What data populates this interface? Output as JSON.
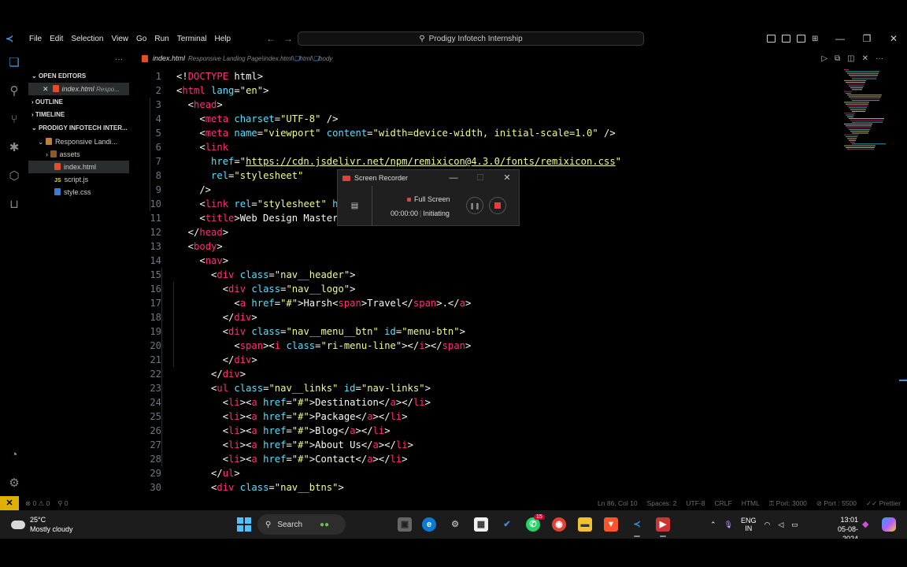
{
  "menu": [
    "File",
    "Edit",
    "Selection",
    "View",
    "Go",
    "Run",
    "Terminal",
    "Help"
  ],
  "command_center": "Prodigy Infotech Internship",
  "sidebar": {
    "open_editors": "OPEN EDITORS",
    "open_file": "index.html",
    "open_file_hint": "Respo...",
    "outline": "OUTLINE",
    "timeline": "TIMELINE",
    "workspace": "PRODIGY INFOTECH INTER...",
    "folder": "Responsive Landi...",
    "items": [
      "assets",
      "index.html",
      "script.js",
      "style.css"
    ]
  },
  "tab": {
    "label": "index.html",
    "breadcrumb": "Responsive Landing Page\\index.html\\",
    "crumb_html": "html",
    "crumb_body": "body"
  },
  "code_lines": [
    [
      [
        "p",
        "<!"
      ],
      [
        "t",
        "DOCTYPE"
      ],
      [
        "p",
        " html>"
      ]
    ],
    [
      [
        "p",
        "<"
      ],
      [
        "t",
        "html"
      ],
      [
        "a",
        " lang"
      ],
      [
        "p",
        "="
      ],
      [
        "s",
        "\"en\""
      ],
      [
        "p",
        ">"
      ]
    ],
    [
      [
        "p",
        "  <"
      ],
      [
        "t",
        "head"
      ],
      [
        "p",
        ">"
      ]
    ],
    [
      [
        "p",
        "    <"
      ],
      [
        "t",
        "meta"
      ],
      [
        "a",
        " charset"
      ],
      [
        "p",
        "="
      ],
      [
        "s",
        "\"UTF-8\""
      ],
      [
        "p",
        " />"
      ]
    ],
    [
      [
        "p",
        "    <"
      ],
      [
        "t",
        "meta"
      ],
      [
        "a",
        " name"
      ],
      [
        "p",
        "="
      ],
      [
        "s",
        "\"viewport\""
      ],
      [
        "a",
        " content"
      ],
      [
        "p",
        "="
      ],
      [
        "s",
        "\"width=device-width, initial-scale=1.0\""
      ],
      [
        "p",
        " />"
      ]
    ],
    [
      [
        "p",
        "    <"
      ],
      [
        "t",
        "link"
      ]
    ],
    [
      [
        "a",
        "      href"
      ],
      [
        "p",
        "="
      ],
      [
        "s",
        "\""
      ],
      [
        "u",
        "https://cdn.jsdelivr.net/npm/remixicon@4.3.0/fonts/remixicon.css"
      ],
      [
        "s",
        "\""
      ]
    ],
    [
      [
        "a",
        "      rel"
      ],
      [
        "p",
        "="
      ],
      [
        "s",
        "\"stylesheet\""
      ]
    ],
    [
      [
        "p",
        "    />"
      ]
    ],
    [
      [
        "p",
        "    <"
      ],
      [
        "t",
        "link"
      ],
      [
        "a",
        " rel"
      ],
      [
        "p",
        "="
      ],
      [
        "s",
        "\"stylesheet\""
      ],
      [
        "a",
        " h"
      ]
    ],
    [
      [
        "p",
        "    <"
      ],
      [
        "t",
        "title"
      ],
      [
        "p",
        ">Web Design Master"
      ]
    ],
    [
      [
        "p",
        "  </"
      ],
      [
        "t",
        "head"
      ],
      [
        "p",
        ">"
      ]
    ],
    [
      [
        "p",
        "  <"
      ],
      [
        "t",
        "body"
      ],
      [
        "p",
        ">"
      ]
    ],
    [
      [
        "p",
        "    <"
      ],
      [
        "t",
        "nav"
      ],
      [
        "p",
        ">"
      ]
    ],
    [
      [
        "p",
        "      <"
      ],
      [
        "t",
        "div"
      ],
      [
        "a",
        " class"
      ],
      [
        "p",
        "="
      ],
      [
        "s",
        "\"nav__header\""
      ],
      [
        "p",
        ">"
      ]
    ],
    [
      [
        "p",
        "        <"
      ],
      [
        "t",
        "div"
      ],
      [
        "a",
        " class"
      ],
      [
        "p",
        "="
      ],
      [
        "s",
        "\"nav__logo\""
      ],
      [
        "p",
        ">"
      ]
    ],
    [
      [
        "p",
        "          <"
      ],
      [
        "t",
        "a"
      ],
      [
        "a",
        " href"
      ],
      [
        "p",
        "="
      ],
      [
        "s",
        "\"#\""
      ],
      [
        "p",
        ">Harsh<"
      ],
      [
        "t",
        "span"
      ],
      [
        "p",
        ">Travel</"
      ],
      [
        "t",
        "span"
      ],
      [
        "p",
        ">.</"
      ],
      [
        "t",
        "a"
      ],
      [
        "p",
        ">"
      ]
    ],
    [
      [
        "p",
        "        </"
      ],
      [
        "t",
        "div"
      ],
      [
        "p",
        ">"
      ]
    ],
    [
      [
        "p",
        "        <"
      ],
      [
        "t",
        "div"
      ],
      [
        "a",
        " class"
      ],
      [
        "p",
        "="
      ],
      [
        "s",
        "\"nav__menu__btn\""
      ],
      [
        "a",
        " id"
      ],
      [
        "p",
        "="
      ],
      [
        "s",
        "\"menu-btn\""
      ],
      [
        "p",
        ">"
      ]
    ],
    [
      [
        "p",
        "          <"
      ],
      [
        "t",
        "span"
      ],
      [
        "p",
        "><"
      ],
      [
        "t",
        "i"
      ],
      [
        "a",
        " class"
      ],
      [
        "p",
        "="
      ],
      [
        "s",
        "\"ri-menu-line\""
      ],
      [
        "p",
        "></"
      ],
      [
        "t",
        "i"
      ],
      [
        "p",
        "></"
      ],
      [
        "t",
        "span"
      ],
      [
        "p",
        ">"
      ]
    ],
    [
      [
        "p",
        "        </"
      ],
      [
        "t",
        "div"
      ],
      [
        "p",
        ">"
      ]
    ],
    [
      [
        "p",
        "      </"
      ],
      [
        "t",
        "div"
      ],
      [
        "p",
        ">"
      ]
    ],
    [
      [
        "p",
        "      <"
      ],
      [
        "t",
        "ul"
      ],
      [
        "a",
        " class"
      ],
      [
        "p",
        "="
      ],
      [
        "s",
        "\"nav__links\""
      ],
      [
        "a",
        " id"
      ],
      [
        "p",
        "="
      ],
      [
        "s",
        "\"nav-links\""
      ],
      [
        "p",
        ">"
      ]
    ],
    [
      [
        "p",
        "        <"
      ],
      [
        "t",
        "li"
      ],
      [
        "p",
        "><"
      ],
      [
        "t",
        "a"
      ],
      [
        "a",
        " href"
      ],
      [
        "p",
        "="
      ],
      [
        "s",
        "\"#\""
      ],
      [
        "p",
        ">Destination</"
      ],
      [
        "t",
        "a"
      ],
      [
        "p",
        "></"
      ],
      [
        "t",
        "li"
      ],
      [
        "p",
        ">"
      ]
    ],
    [
      [
        "p",
        "        <"
      ],
      [
        "t",
        "li"
      ],
      [
        "p",
        "><"
      ],
      [
        "t",
        "a"
      ],
      [
        "a",
        " href"
      ],
      [
        "p",
        "="
      ],
      [
        "s",
        "\"#\""
      ],
      [
        "p",
        ">Package</"
      ],
      [
        "t",
        "a"
      ],
      [
        "p",
        "></"
      ],
      [
        "t",
        "li"
      ],
      [
        "p",
        ">"
      ]
    ],
    [
      [
        "p",
        "        <"
      ],
      [
        "t",
        "li"
      ],
      [
        "p",
        "><"
      ],
      [
        "t",
        "a"
      ],
      [
        "a",
        " href"
      ],
      [
        "p",
        "="
      ],
      [
        "s",
        "\"#\""
      ],
      [
        "p",
        ">Blog</"
      ],
      [
        "t",
        "a"
      ],
      [
        "p",
        "></"
      ],
      [
        "t",
        "li"
      ],
      [
        "p",
        ">"
      ]
    ],
    [
      [
        "p",
        "        <"
      ],
      [
        "t",
        "li"
      ],
      [
        "p",
        "><"
      ],
      [
        "t",
        "a"
      ],
      [
        "a",
        " href"
      ],
      [
        "p",
        "="
      ],
      [
        "s",
        "\"#\""
      ],
      [
        "p",
        ">About Us</"
      ],
      [
        "t",
        "a"
      ],
      [
        "p",
        "></"
      ],
      [
        "t",
        "li"
      ],
      [
        "p",
        ">"
      ]
    ],
    [
      [
        "p",
        "        <"
      ],
      [
        "t",
        "li"
      ],
      [
        "p",
        "><"
      ],
      [
        "t",
        "a"
      ],
      [
        "a",
        " href"
      ],
      [
        "p",
        "="
      ],
      [
        "s",
        "\"#\""
      ],
      [
        "p",
        ">Contact</"
      ],
      [
        "t",
        "a"
      ],
      [
        "p",
        "></"
      ],
      [
        "t",
        "li"
      ],
      [
        "p",
        ">"
      ]
    ],
    [
      [
        "p",
        "      </"
      ],
      [
        "t",
        "ul"
      ],
      [
        "p",
        ">"
      ]
    ],
    [
      [
        "p",
        "      <"
      ],
      [
        "t",
        "div"
      ],
      [
        "a",
        " class"
      ],
      [
        "p",
        "="
      ],
      [
        "s",
        "\"nav__btns\""
      ],
      [
        "p",
        ">"
      ]
    ]
  ],
  "recorder": {
    "title": "Screen Recorder",
    "mode": "Full Screen",
    "time": "00:00:00",
    "status": "Initiating"
  },
  "status": {
    "errors": "0",
    "warnings": "0",
    "ports": "0",
    "position": "Ln 86, Col 10",
    "spaces": "Spaces: 2",
    "encoding": "UTF-8",
    "eol": "CRLF",
    "lang": "HTML",
    "port": "Port: 3000",
    "port2": "Port : 5500",
    "prettier": "Prettier"
  },
  "taskbar": {
    "temp": "25°C",
    "weather": "Mostly cloudy",
    "search": "Search",
    "badge": "15",
    "lang1": "ENG",
    "lang2": "IN",
    "time": "13:01",
    "date": "05-08-2024"
  },
  "colors": {
    "tag": "#ff2d7a",
    "attr": "#57e0ff",
    "string": "#f1fa8c",
    "text": "#f8f8f2",
    "accent": "#3a96dd"
  }
}
